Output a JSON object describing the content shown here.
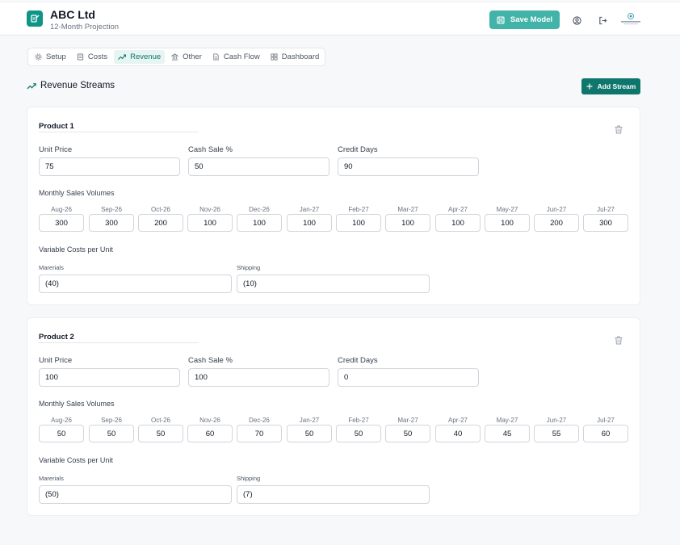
{
  "app": {
    "title": "ABC Ltd",
    "subtitle": "12-Month Projection"
  },
  "header": {
    "save_label": "Save Model"
  },
  "tabs": [
    {
      "label": "Setup",
      "icon": "gear-icon"
    },
    {
      "label": "Costs",
      "icon": "receipt-icon"
    },
    {
      "label": "Revenue",
      "icon": "trending-up-icon",
      "active": true
    },
    {
      "label": "Other",
      "icon": "bank-icon"
    },
    {
      "label": "Cash Flow",
      "icon": "document-icon"
    },
    {
      "label": "Dashboard",
      "icon": "grid-icon"
    }
  ],
  "section": {
    "title": "Revenue Streams",
    "add_label": "Add Stream"
  },
  "labels": {
    "unit_price": "Unit Price",
    "cash_sale": "Cash Sale %",
    "credit_days": "Credit Days",
    "monthly_volumes": "Monthly Sales Volumes",
    "variable_costs": "Variable Costs per Unit"
  },
  "months": [
    "Aug-26",
    "Sep-26",
    "Oct-26",
    "Nov-26",
    "Dec-26",
    "Jan-27",
    "Feb-27",
    "Mar-27",
    "Apr-27",
    "May-27",
    "Jun-27",
    "Jul-27"
  ],
  "products": [
    {
      "name": "Product 1",
      "unit_price": "75",
      "cash_sale": "50",
      "credit_days": "90",
      "volumes": [
        "300",
        "300",
        "200",
        "100",
        "100",
        "100",
        "100",
        "100",
        "100",
        "100",
        "200",
        "300"
      ],
      "costs": [
        {
          "label": "Marerials",
          "value": "(40)"
        },
        {
          "label": "Shipping",
          "value": "(10)"
        }
      ]
    },
    {
      "name": "Product 2",
      "unit_price": "100",
      "cash_sale": "100",
      "credit_days": "0",
      "volumes": [
        "50",
        "50",
        "50",
        "60",
        "70",
        "50",
        "50",
        "50",
        "40",
        "45",
        "55",
        "60"
      ],
      "costs": [
        {
          "label": "Marerials",
          "value": "(50)"
        },
        {
          "label": "Shipping",
          "value": "(7)"
        }
      ]
    }
  ],
  "colors": {
    "accent": "#0f766e",
    "save": "#42b3a8",
    "logo": "#0f9488"
  }
}
